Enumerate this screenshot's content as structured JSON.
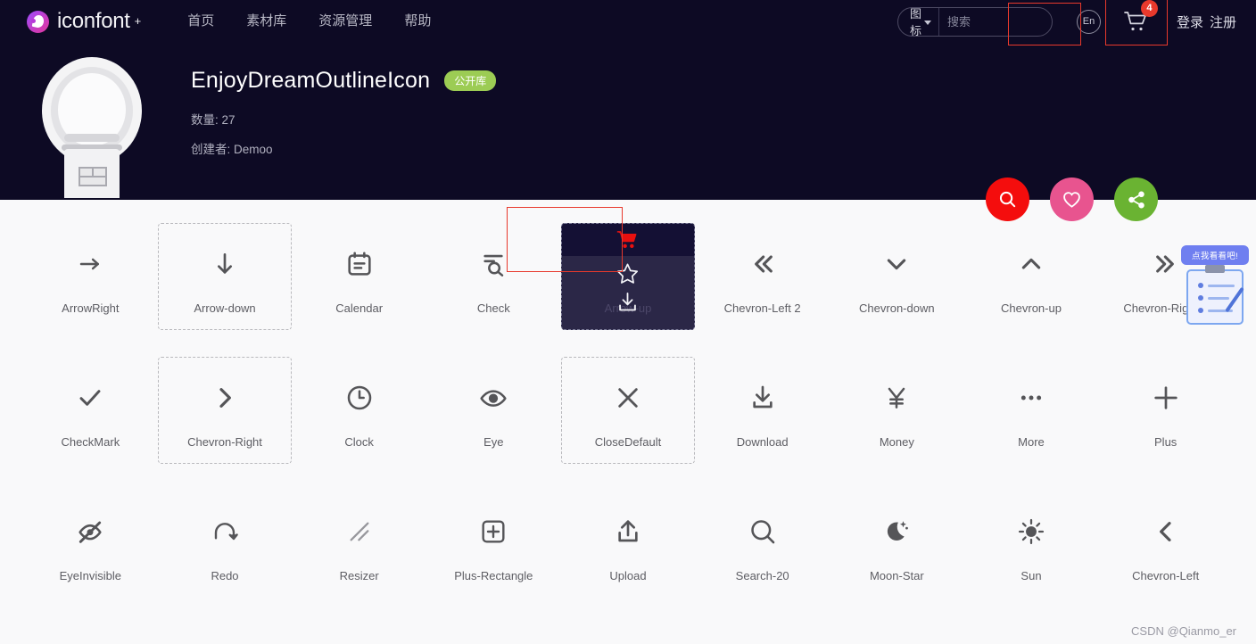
{
  "topbar": {
    "brand": "iconfont",
    "brand_plus": "+",
    "nav": [
      {
        "label": "首页",
        "name": "nav-home"
      },
      {
        "label": "素材库",
        "name": "nav-library"
      },
      {
        "label": "资源管理",
        "name": "nav-resources"
      },
      {
        "label": "帮助",
        "name": "nav-help"
      }
    ],
    "search": {
      "category": "图标",
      "placeholder": "搜索",
      "value": ""
    },
    "lang_label": "En",
    "cart_count": "4",
    "login": "登录",
    "register": "注册"
  },
  "hero": {
    "title": "EnjoyDreamOutlineIcon",
    "badge": "公开库",
    "count_label": "数量:",
    "count_value": "27",
    "author_label": "创建者:",
    "author_value": "Demoo",
    "actions": [
      {
        "name": "search-project-button",
        "icon": "search-icon",
        "color": "#f40d0d"
      },
      {
        "name": "favorite-project-button",
        "icon": "heart-icon",
        "color": "#e8548f"
      },
      {
        "name": "share-project-button",
        "icon": "share-icon",
        "color": "#6ab332"
      }
    ]
  },
  "icon_grid": {
    "active_index": 4,
    "hover_outline_indices": [
      1,
      10,
      13
    ],
    "overlay_actions": [
      {
        "name": "add-to-cart-icon",
        "label": "cart-icon"
      },
      {
        "name": "favorite-icon",
        "label": "star-icon"
      },
      {
        "name": "download-icon",
        "label": "download-icon"
      }
    ],
    "items": [
      {
        "label": "ArrowRight",
        "icon": "arrow-right-icon"
      },
      {
        "label": "Arrow-down",
        "icon": "arrow-down-icon"
      },
      {
        "label": "Calendar",
        "icon": "calendar-icon"
      },
      {
        "label": "Check",
        "icon": "check-search-icon"
      },
      {
        "label": "Arrow-up",
        "icon": "arrow-up-icon"
      },
      {
        "label": "Chevron-Left 2",
        "icon": "chevron-double-left-icon"
      },
      {
        "label": "Chevron-down",
        "icon": "chevron-down-icon"
      },
      {
        "label": "Chevron-up",
        "icon": "chevron-up-icon"
      },
      {
        "label": "Chevron-Right 2",
        "icon": "chevron-double-right-icon"
      },
      {
        "label": "CheckMark",
        "icon": "checkmark-icon"
      },
      {
        "label": "Chevron-Right",
        "icon": "chevron-right-icon"
      },
      {
        "label": "Clock",
        "icon": "clock-icon"
      },
      {
        "label": "Eye",
        "icon": "eye-icon"
      },
      {
        "label": "CloseDefault",
        "icon": "close-icon"
      },
      {
        "label": "Download",
        "icon": "download-icon"
      },
      {
        "label": "Money",
        "icon": "yen-icon"
      },
      {
        "label": "More",
        "icon": "more-dots-icon"
      },
      {
        "label": "Plus",
        "icon": "plus-icon"
      },
      {
        "label": "EyeInvisible",
        "icon": "eye-invisible-icon"
      },
      {
        "label": "Redo",
        "icon": "redo-icon"
      },
      {
        "label": "Resizer",
        "icon": "resizer-icon"
      },
      {
        "label": "Plus-Rectangle",
        "icon": "plus-rectangle-icon"
      },
      {
        "label": "Upload",
        "icon": "upload-icon"
      },
      {
        "label": "Search-20",
        "icon": "search-icon"
      },
      {
        "label": "Moon-Star",
        "icon": "moon-star-icon"
      },
      {
        "label": "Sun",
        "icon": "sun-icon"
      },
      {
        "label": "Chevron-Left",
        "icon": "chevron-left-icon"
      }
    ]
  },
  "survey_widget": {
    "bubble_text": "点我看看吧!"
  },
  "watermark": "CSDN @Qianmo_er",
  "colors": {
    "header_bg": "#0d0a24",
    "page_bg": "#f9f9fa",
    "accent_red": "#e8392c",
    "badge_green": "#9ccc54"
  }
}
